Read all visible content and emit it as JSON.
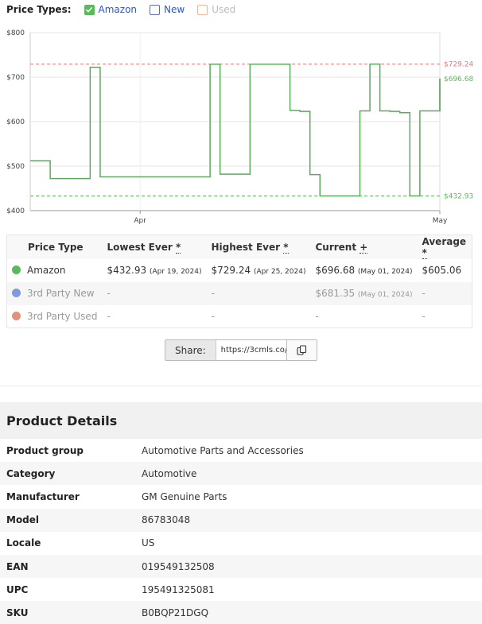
{
  "price_types": {
    "label": "Price Types:",
    "options": [
      {
        "label": "Amazon",
        "checked": true,
        "enabled": true
      },
      {
        "label": "New",
        "checked": false,
        "enabled": true
      },
      {
        "label": "Used",
        "checked": false,
        "enabled": false
      }
    ]
  },
  "chart_data": {
    "type": "line",
    "y_ticks": [
      "$800",
      "$700",
      "$600",
      "$500",
      "$400"
    ],
    "ylim": [
      400,
      800
    ],
    "x_ticks": [
      "Apr",
      "May"
    ],
    "x_range": [
      "2024-03-21",
      "2024-05-01"
    ],
    "grid": true,
    "series": [
      {
        "name": "Amazon",
        "color": "#5fa85f",
        "x": [
          "2024-03-21",
          "2024-03-23",
          "2024-03-27",
          "2024-03-28",
          "2024-04-08",
          "2024-04-09",
          "2024-04-12",
          "2024-04-16",
          "2024-04-17",
          "2024-04-18",
          "2024-04-19",
          "2024-04-23",
          "2024-04-24",
          "2024-04-25",
          "2024-04-26",
          "2024-04-27",
          "2024-04-28",
          "2024-04-29",
          "2024-04-30",
          "2024-05-01"
        ],
        "values": [
          512,
          472,
          722,
          476,
          729,
          482,
          729,
          625,
          623,
          481,
          432.93,
          624,
          729.24,
          624,
          623,
          620,
          433,
          624,
          624,
          696.68
        ],
        "ranges": [
          [
            512,
            512
          ],
          [
            472,
            472
          ],
          [
            722,
            722
          ],
          [
            476,
            476
          ],
          [
            729,
            729
          ],
          [
            482,
            482
          ],
          [
            729,
            729
          ],
          [
            625,
            625
          ],
          [
            623,
            623
          ],
          [
            481,
            481
          ],
          [
            432.93,
            432.93
          ],
          [
            624,
            624
          ],
          [
            729.24,
            729.24
          ],
          [
            624,
            624
          ],
          [
            623,
            623
          ],
          [
            620,
            620
          ],
          [
            433,
            433
          ],
          [
            624,
            624
          ],
          [
            624,
            624
          ],
          [
            696.68,
            696.68
          ]
        ]
      }
    ],
    "reference_lines": [
      {
        "label": "$729.24",
        "value": 729.24,
        "color": "#e07a7a"
      },
      {
        "label": "$696.68",
        "value": 696.68,
        "color": "#5cb85c"
      },
      {
        "label": "$432.93",
        "value": 432.93,
        "color": "#5cb85c"
      }
    ]
  },
  "price_table": {
    "headers": [
      "Price Type",
      "Lowest Ever",
      "Highest Ever",
      "Current",
      "Average"
    ],
    "header_marks": [
      "",
      "*",
      "*",
      "+",
      "*"
    ],
    "rows": [
      {
        "type": "Amazon",
        "dot": "#5cb85c",
        "muted": false,
        "lowest": "$432.93",
        "lowest_date": "(Apr 19, 2024)",
        "highest": "$729.24",
        "highest_date": "(Apr 25, 2024)",
        "current": "$696.68",
        "current_date": "(May 01, 2024)",
        "average": "$605.06"
      },
      {
        "type": "3rd Party New",
        "dot": "#7f9bde",
        "muted": true,
        "lowest": "-",
        "lowest_date": "",
        "highest": "-",
        "highest_date": "",
        "current": "$681.35",
        "current_date": "(May 01, 2024)",
        "average": "-"
      },
      {
        "type": "3rd Party Used",
        "dot": "#e3927a",
        "muted": true,
        "lowest": "-",
        "lowest_date": "",
        "highest": "-",
        "highest_date": "",
        "current": "-",
        "current_date": "",
        "average": "-"
      }
    ]
  },
  "share": {
    "label": "Share:",
    "url": "https://3cmls.co/"
  },
  "product_details": {
    "title": "Product Details",
    "rows": [
      {
        "key": "Product group",
        "value": "Automotive Parts and Accessories"
      },
      {
        "key": "Category",
        "value": "Automotive"
      },
      {
        "key": "Manufacturer",
        "value": "GM Genuine Parts"
      },
      {
        "key": "Model",
        "value": "86783048"
      },
      {
        "key": "Locale",
        "value": "US"
      },
      {
        "key": "EAN",
        "value": "019549132508"
      },
      {
        "key": "UPC",
        "value": "195491325081"
      },
      {
        "key": "SKU",
        "value": "B0BQP21DGQ"
      }
    ]
  }
}
